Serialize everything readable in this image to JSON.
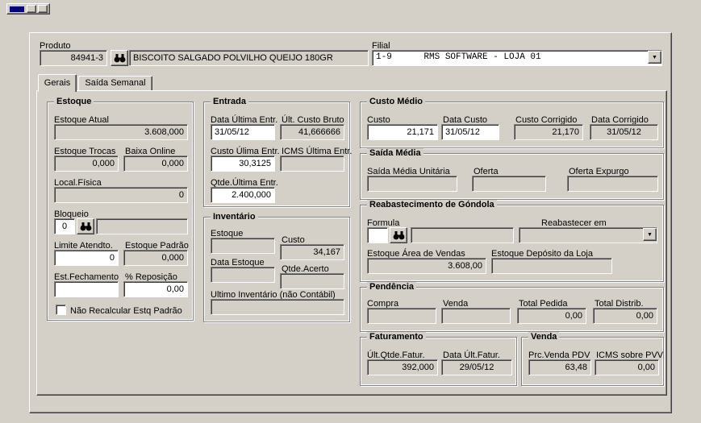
{
  "header": {
    "produto_label": "Produto",
    "produto_codigo": "84941-3",
    "produto_nome": "BISCOITO SALGADO POLVILHO QUEIJO 180GR",
    "filial_label": "Filial",
    "filial_valor": "1-9      RMS SOFTWARE - LOJA 01"
  },
  "tabs": {
    "gerais": "Gerais",
    "saida_semanal": "Saída Semanal"
  },
  "estoque": {
    "title": "Estoque",
    "estoque_atual_label": "Estoque Atual",
    "estoque_atual": "3.608,000",
    "estoque_trocas_label": "Estoque Trocas",
    "estoque_trocas": "0,000",
    "baixa_online_label": "Baixa Online",
    "baixa_online": "0,000",
    "local_fisica_label": "Local.Física",
    "local_fisica": "0",
    "bloqueio_label": "Bloqueio",
    "bloqueio_codigo": "0",
    "bloqueio_descricao": "",
    "limite_atendto_label": "Limite Atendto.",
    "limite_atendto": "0",
    "estoque_padrao_label": "Estoque Padrão",
    "estoque_padrao": "0,000",
    "est_fechamento_label": "Est.Fechamento",
    "est_fechamento": "",
    "reposicao_label": "% Reposição",
    "reposicao": "0,00",
    "nao_recalcular_label": "Não Recalcular Estq Padrão"
  },
  "entrada": {
    "title": "Entrada",
    "data_ultima_entr_label": "Data Última Entr.",
    "data_ultima_entr": "31/05/12",
    "ult_custo_bruto_label": "Últ. Custo Bruto",
    "ult_custo_bruto": "41,666666",
    "custo_ulima_entr_label": "Custo Úlima Entr.",
    "custo_ulima_entr": "30,3125",
    "icms_ultima_entr_label": "ICMS Última Entr.",
    "icms_ultima_entr": "",
    "qtde_ultima_entr_label": "Qtde.Última Entr.",
    "qtde_ultima_entr": "2.400,000"
  },
  "inventario": {
    "title": "Inventário",
    "estoque_label": "Estoque",
    "estoque": "",
    "custo_label": "Custo",
    "custo": "34,167",
    "data_estoque_label": "Data Estoque",
    "data_estoque": "",
    "qtde_acerto_label": "Qtde.Acerto",
    "qtde_acerto": "",
    "ultimo_inventario_label": "Ultimo Inventário (não Contábil)",
    "ultimo_inventario": ""
  },
  "custo_medio": {
    "title": "Custo Médio",
    "custo_label": "Custo",
    "custo": "21,171",
    "data_custo_label": "Data Custo",
    "data_custo": "31/05/12",
    "custo_corrigido_label": "Custo Corrigido",
    "custo_corrigido": "21,170",
    "data_corrigido_label": "Data Corrigido",
    "data_corrigido": "31/05/12"
  },
  "saida_media": {
    "title": "Saída Média",
    "unitaria_label": "Saída Média Unitária",
    "unitaria": "",
    "oferta_label": "Oferta",
    "oferta": "",
    "oferta_expurgo_label": "Oferta Expurgo",
    "oferta_expurgo": ""
  },
  "reabastecimento": {
    "title": "Reabastecimento de Góndola",
    "formula_label": "Formula",
    "formula_codigo": "",
    "formula_descricao": "",
    "reabastecer_em_label": "Reabastecer em",
    "reabastecer_em": "",
    "estoque_area_vendas_label": "Estoque Área de Vendas",
    "estoque_area_vendas": "3.608,00",
    "estoque_deposito_label": "Estoque Depósito da Loja",
    "estoque_deposito": ""
  },
  "pendencia": {
    "title": "Pendência",
    "compra_label": "Compra",
    "compra": "",
    "venda_label": "Venda",
    "venda": "",
    "total_pedida_label": "Total Pedida",
    "total_pedida": "0,00",
    "total_distrib_label": "Total  Distrib.",
    "total_distrib": "0,00"
  },
  "faturamento": {
    "title": "Faturamento",
    "ult_qtde_fatur_label": "Últ.Qtde.Fatur.",
    "ult_qtde_fatur": "392,000",
    "data_ult_fatur_label": "Data Últ.Fatur.",
    "data_ult_fatur": "29/05/12"
  },
  "venda": {
    "title": "Venda",
    "prc_venda_pdv_label": "Prc.Venda PDV",
    "prc_venda_pdv": "63,48",
    "icms_sobre_pvv_label": "ICMS sobre PVV",
    "icms_sobre_pvv": "0,00"
  }
}
